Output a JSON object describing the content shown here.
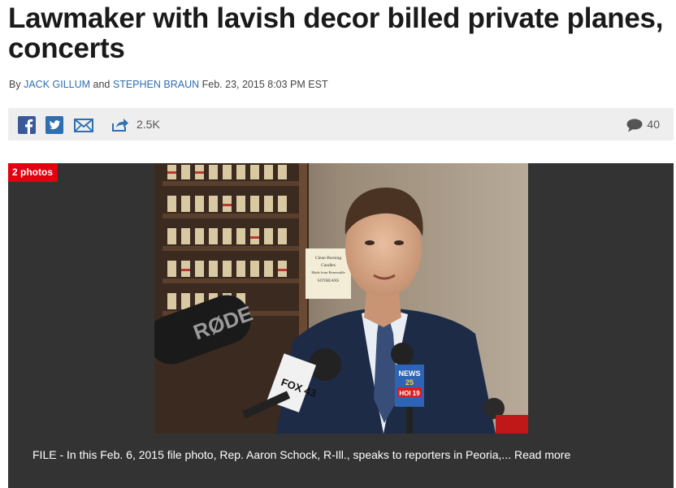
{
  "article": {
    "headline": "Lawmaker with lavish decor billed private planes, concerts",
    "byline_prefix": "By",
    "author1": "JACK GILLUM",
    "byline_and": "and",
    "author2": "STEPHEN BRAUN",
    "dateline": "Feb. 23, 2015 8:03 PM EST"
  },
  "share": {
    "share_count": "2.5K",
    "comment_count": "40",
    "icons": [
      "facebook-icon",
      "twitter-icon",
      "email-icon",
      "share-icon",
      "comment-icon"
    ]
  },
  "gallery": {
    "badge": "2 photos",
    "caption": "FILE - In this Feb. 6, 2015 file photo, Rep. Aaron Schock, R-Ill., speaks to reporters in Peoria,...",
    "read_more": "Read more",
    "photo_texts": {
      "mic1": "RØDE",
      "mic2": "FOX 43",
      "mic3_line1": "NEWS",
      "mic3_line2": "25",
      "mic3_line3": "HOI 19",
      "sign_line1": "Clean Burning",
      "sign_line2": "Candles",
      "sign_line3": "Made from Renewable",
      "sign_line4": "SOYBEANS"
    }
  },
  "colors": {
    "link": "#2f6fb0",
    "badge": "#e4000f",
    "facebook": "#3b5998",
    "twitter": "#1da1f2",
    "icon_blue": "#2f6fb0",
    "gallery_bg": "#333333",
    "share_bar": "#eeeeee"
  }
}
